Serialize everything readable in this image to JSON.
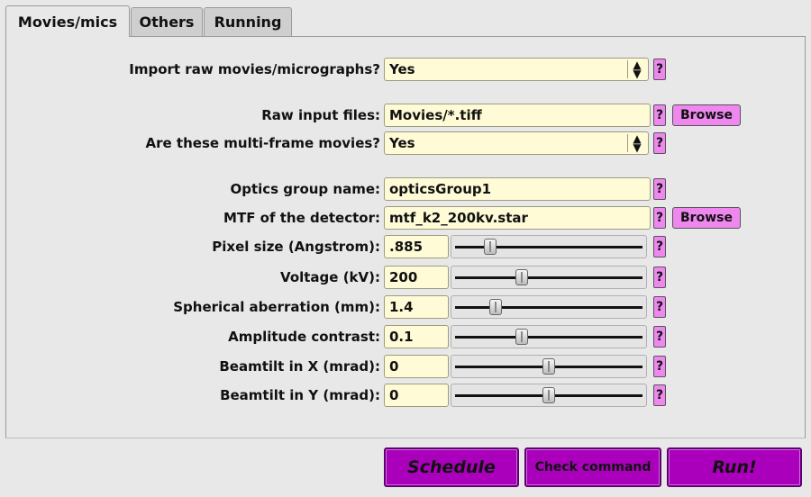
{
  "tabs": [
    {
      "label": "Movies/mics",
      "active": true
    },
    {
      "label": "Others",
      "active": false
    },
    {
      "label": "Running",
      "active": false
    }
  ],
  "form": {
    "import_raw": {
      "label": "Import raw movies/micrographs?",
      "value": "Yes"
    },
    "raw_input": {
      "label": "Raw input files:",
      "value": "Movies/*.tiff"
    },
    "multi_frame": {
      "label": "Are these multi-frame movies?",
      "value": "Yes"
    },
    "optics_group": {
      "label": "Optics group name:",
      "value": "opticsGroup1"
    },
    "mtf": {
      "label": "MTF of the detector:",
      "value": "mtf_k2_200kv.star"
    },
    "pixel_size": {
      "label": "Pixel size (Angstrom):",
      "value": ".885",
      "slider_fraction": 0.18
    },
    "voltage": {
      "label": "Voltage (kV):",
      "value": "200",
      "slider_fraction": 0.35
    },
    "cs": {
      "label": "Spherical aberration (mm):",
      "value": "1.4",
      "slider_fraction": 0.21
    },
    "amp_contrast": {
      "label": "Amplitude contrast:",
      "value": "0.1",
      "slider_fraction": 0.35
    },
    "beamtilt_x": {
      "label": "Beamtilt in X (mrad):",
      "value": "0",
      "slider_fraction": 0.5
    },
    "beamtilt_y": {
      "label": "Beamtilt in Y (mrad):",
      "value": "0",
      "slider_fraction": 0.5
    }
  },
  "help_label": "?",
  "browse_label": "Browse",
  "actions": {
    "schedule": "Schedule",
    "check": "Check command",
    "run": "Run!"
  },
  "colors": {
    "field_bg": "#fffbd6",
    "help_bg": "#ee88ee",
    "action_bg": "#aa00bb"
  }
}
